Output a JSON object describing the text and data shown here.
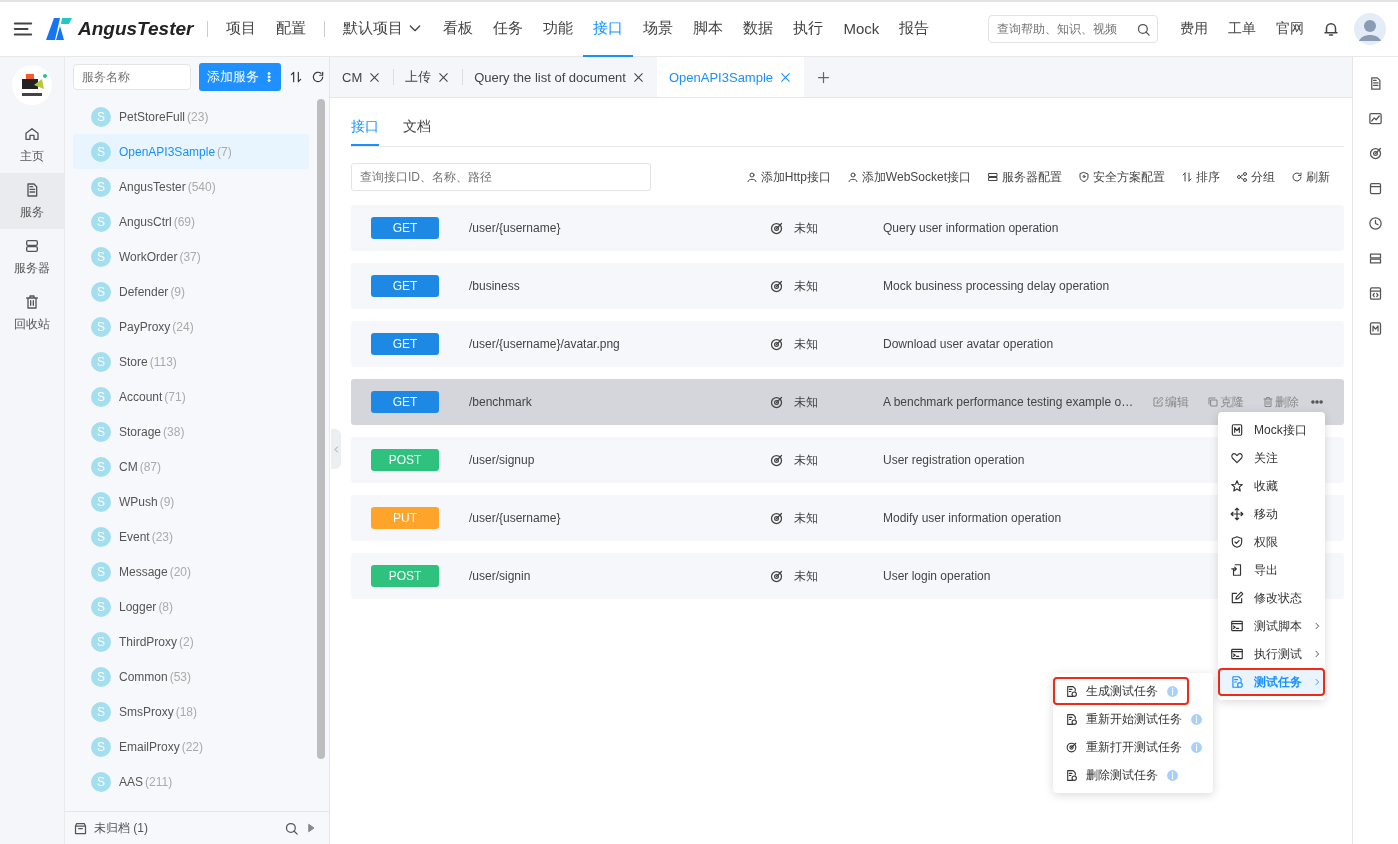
{
  "nav": {
    "brand": "AngusTester",
    "items": [
      {
        "label": "项目",
        "kind": "link",
        "selected": false,
        "divider_before": true
      },
      {
        "label": "配置",
        "kind": "link",
        "selected": false,
        "divider_before": false
      },
      {
        "label": "默认项目",
        "kind": "dropdown",
        "selected": false,
        "divider_before": true
      },
      {
        "label": "看板",
        "kind": "link",
        "selected": false,
        "divider_before": false
      },
      {
        "label": "任务",
        "kind": "link",
        "selected": false,
        "divider_before": false
      },
      {
        "label": "功能",
        "kind": "link",
        "selected": false,
        "divider_before": false
      },
      {
        "label": "接口",
        "kind": "link",
        "selected": true,
        "divider_before": false
      },
      {
        "label": "场景",
        "kind": "link",
        "selected": false,
        "divider_before": false
      },
      {
        "label": "脚本",
        "kind": "link",
        "selected": false,
        "divider_before": false
      },
      {
        "label": "数据",
        "kind": "link",
        "selected": false,
        "divider_before": false
      },
      {
        "label": "执行",
        "kind": "link",
        "selected": false,
        "divider_before": false
      },
      {
        "label": "Mock",
        "kind": "link",
        "selected": false,
        "divider_before": false
      },
      {
        "label": "报告",
        "kind": "link",
        "selected": false,
        "divider_before": false
      }
    ],
    "search": {
      "placeholder": "查询帮助、知识、视频"
    },
    "links": [
      "费用",
      "工单",
      "官网"
    ]
  },
  "rail": {
    "items": [
      {
        "label": "主页",
        "selected": false
      },
      {
        "label": "服务",
        "selected": true
      },
      {
        "label": "服务器",
        "selected": false
      },
      {
        "label": "回收站",
        "selected": false
      }
    ]
  },
  "services": {
    "search": {
      "placeholder": "服务名称"
    },
    "add_button": "添加服务",
    "items": [
      {
        "avatar": "S",
        "name": "PetStoreFull",
        "count": "(23)",
        "selected": false
      },
      {
        "avatar": "S",
        "name": "OpenAPI3Sample",
        "count": "(7)",
        "selected": true
      },
      {
        "avatar": "S",
        "name": "AngusTester",
        "count": "(540)",
        "selected": false
      },
      {
        "avatar": "S",
        "name": "AngusCtrl",
        "count": "(69)",
        "selected": false
      },
      {
        "avatar": "S",
        "name": "WorkOrder",
        "count": "(37)",
        "selected": false
      },
      {
        "avatar": "S",
        "name": "Defender",
        "count": "(9)",
        "selected": false
      },
      {
        "avatar": "S",
        "name": "PayProxy",
        "count": "(24)",
        "selected": false
      },
      {
        "avatar": "S",
        "name": "Store",
        "count": "(113)",
        "selected": false
      },
      {
        "avatar": "S",
        "name": "Account",
        "count": "(71)",
        "selected": false
      },
      {
        "avatar": "S",
        "name": "Storage",
        "count": "(38)",
        "selected": false
      },
      {
        "avatar": "S",
        "name": "CM",
        "count": "(87)",
        "selected": false
      },
      {
        "avatar": "S",
        "name": "WPush",
        "count": "(9)",
        "selected": false
      },
      {
        "avatar": "S",
        "name": "Event",
        "count": "(23)",
        "selected": false
      },
      {
        "avatar": "S",
        "name": "Message",
        "count": "(20)",
        "selected": false
      },
      {
        "avatar": "S",
        "name": "Logger",
        "count": "(8)",
        "selected": false
      },
      {
        "avatar": "S",
        "name": "ThirdProxy",
        "count": "(2)",
        "selected": false
      },
      {
        "avatar": "S",
        "name": "Common",
        "count": "(53)",
        "selected": false
      },
      {
        "avatar": "S",
        "name": "SmsProxy",
        "count": "(18)",
        "selected": false
      },
      {
        "avatar": "S",
        "name": "EmailProxy",
        "count": "(22)",
        "selected": false
      },
      {
        "avatar": "S",
        "name": "AAS",
        "count": "(211)",
        "selected": false
      }
    ],
    "footer": "未归档 (1)"
  },
  "tabs": [
    {
      "label": "CM",
      "selected": false
    },
    {
      "label": "上传",
      "selected": false
    },
    {
      "label": "Query the list of document",
      "selected": false
    },
    {
      "label": "OpenAPI3Sample",
      "selected": true
    }
  ],
  "subtabs": [
    {
      "label": "接口",
      "selected": true
    },
    {
      "label": "文档",
      "selected": false
    }
  ],
  "toolbar": {
    "search": {
      "placeholder": "查询接口ID、名称、路径"
    },
    "actions": [
      "添加Http接口",
      "添加WebSocket接口",
      "服务器配置",
      "安全方案配置",
      "排序",
      "分组",
      "刷新"
    ]
  },
  "apis": [
    {
      "method": "GET",
      "color": "#1e88e5",
      "path": "/user/{username}",
      "status": "未知",
      "summary": "Query user information operation",
      "selected": false
    },
    {
      "method": "GET",
      "color": "#1e88e5",
      "path": "/business",
      "status": "未知",
      "summary": "Mock business processing delay operation",
      "selected": false
    },
    {
      "method": "GET",
      "color": "#1e88e5",
      "path": "/user/{username}/avatar.png",
      "status": "未知",
      "summary": "Download user avatar operation",
      "selected": false
    },
    {
      "method": "GET",
      "color": "#1e88e5",
      "path": "/benchmark",
      "status": "未知",
      "summary": "A benchmark performance testing example o…",
      "selected": true,
      "actions": [
        "编辑",
        "克隆",
        "删除"
      ]
    },
    {
      "method": "POST",
      "color": "#2ec27e",
      "path": "/user/signup",
      "status": "未知",
      "summary": "User registration operation",
      "selected": false
    },
    {
      "method": "PUT",
      "color": "#ffa42b",
      "path": "/user/{username}",
      "status": "未知",
      "summary": "Modify user information operation",
      "selected": false
    },
    {
      "method": "POST",
      "color": "#2ec27e",
      "path": "/user/signin",
      "status": "未知",
      "summary": "User login operation",
      "selected": false
    }
  ],
  "context_menu": {
    "items": [
      {
        "label": "Mock接口",
        "submenu": false,
        "selected": false
      },
      {
        "label": "关注",
        "submenu": false,
        "selected": false
      },
      {
        "label": "收藏",
        "submenu": false,
        "selected": false
      },
      {
        "label": "移动",
        "submenu": false,
        "selected": false
      },
      {
        "label": "权限",
        "submenu": false,
        "selected": false
      },
      {
        "label": "导出",
        "submenu": false,
        "selected": false
      },
      {
        "label": "修改状态",
        "submenu": false,
        "selected": false
      },
      {
        "label": "测试脚本",
        "submenu": true,
        "selected": false
      },
      {
        "label": "执行测试",
        "submenu": true,
        "selected": false
      },
      {
        "label": "测试任务",
        "submenu": true,
        "selected": true
      }
    ]
  },
  "submenu": {
    "items": [
      {
        "label": "生成测试任务",
        "selected": true
      },
      {
        "label": "重新开始测试任务",
        "selected": false
      },
      {
        "label": "重新打开测试任务",
        "selected": false
      },
      {
        "label": "删除测试任务",
        "selected": false
      }
    ]
  }
}
